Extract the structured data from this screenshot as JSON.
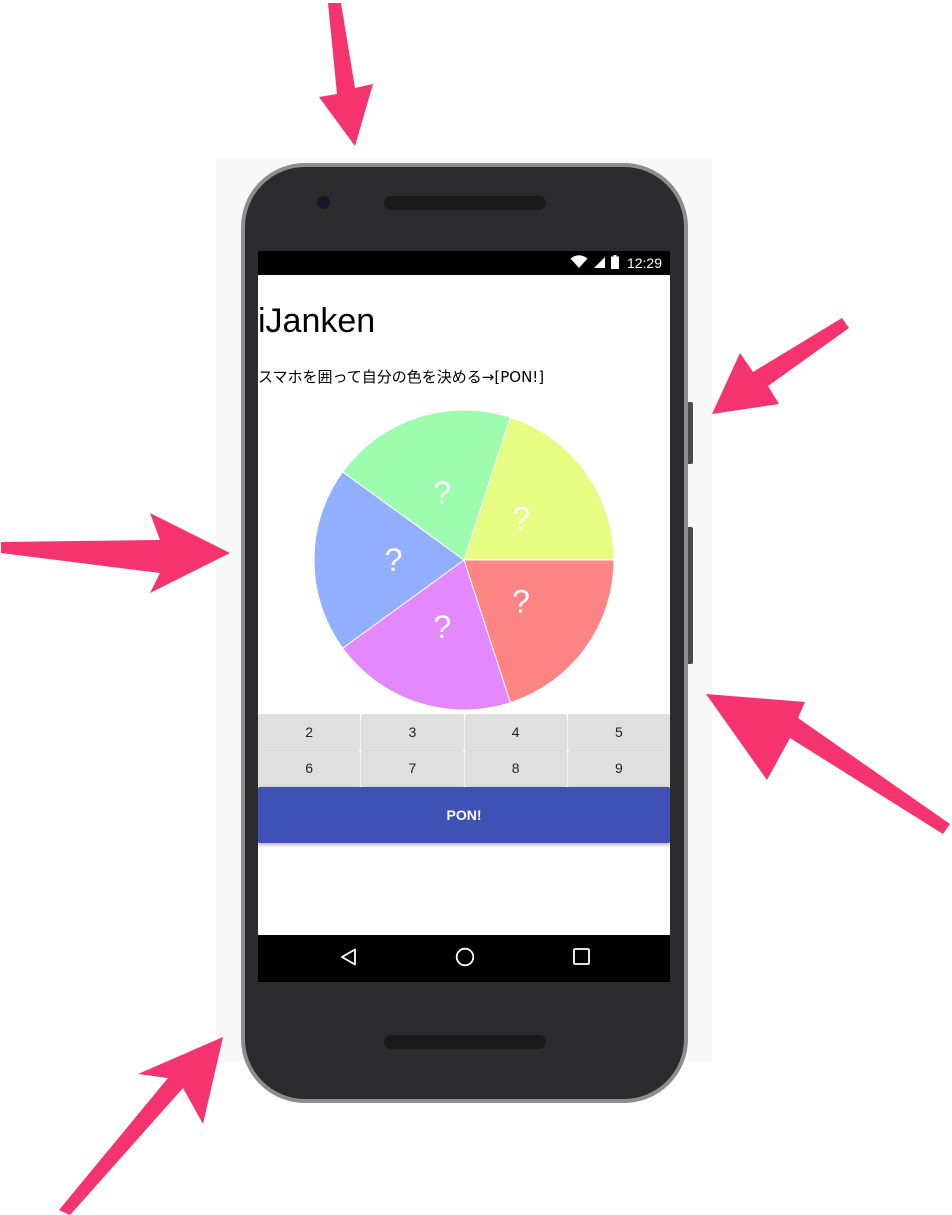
{
  "status_bar": {
    "time": "12:29",
    "icons": [
      "wifi-icon",
      "signal-icon",
      "battery-icon"
    ]
  },
  "app": {
    "title": "iJanken",
    "instruction": "スマホを囲って自分の色を決める→[PON!]"
  },
  "pie": {
    "slices": [
      {
        "label": "?",
        "color": "#ff8585"
      },
      {
        "label": "?",
        "color": "#e388ff"
      },
      {
        "label": "?",
        "color": "#91aeff"
      },
      {
        "label": "?",
        "color": "#9dfcad"
      },
      {
        "label": "?",
        "color": "#e6fc82"
      }
    ]
  },
  "number_buttons": [
    "2",
    "3",
    "4",
    "5",
    "6",
    "7",
    "8",
    "9"
  ],
  "pon_button": {
    "label": "PON!",
    "color": "#3f51b5"
  },
  "nav_bar": {
    "icons": [
      "back-icon",
      "home-icon",
      "recents-icon"
    ]
  },
  "annotation": {
    "arrow_color": "#f5336e"
  }
}
